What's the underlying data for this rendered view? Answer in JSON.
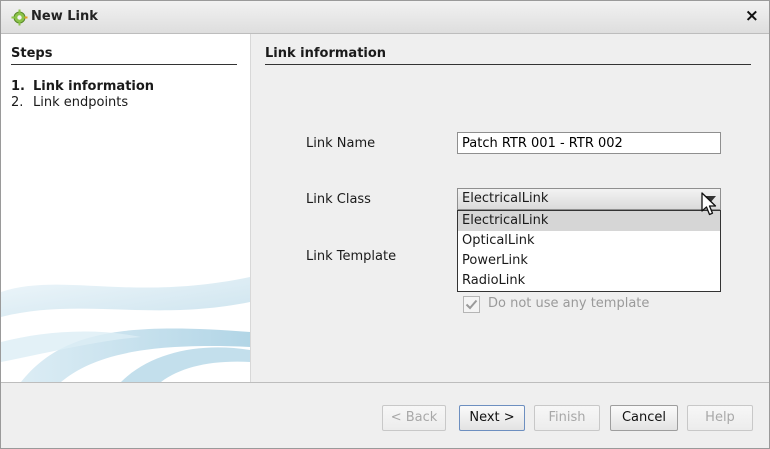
{
  "window": {
    "title": "New Link",
    "close_label": "×",
    "icon": "gear-link-icon"
  },
  "steps": {
    "title": "Steps",
    "items": [
      {
        "num": "1.",
        "label": "Link information",
        "active": true
      },
      {
        "num": "2.",
        "label": "Link endpoints",
        "active": false
      }
    ]
  },
  "content": {
    "title": "Link information",
    "link_name": {
      "label": "Link Name",
      "value": "Patch RTR 001 - RTR 002"
    },
    "link_class": {
      "label": "Link Class",
      "selected": "ElectricalLink",
      "options": [
        "ElectricalLink",
        "OpticalLink",
        "PowerLink",
        "RadioLink"
      ]
    },
    "link_template": {
      "label": "Link Template"
    },
    "no_template_checkbox": {
      "label": "Do not use any template",
      "checked": true,
      "enabled": false
    }
  },
  "footer": {
    "back_label": "< Back",
    "next_label": "Next >",
    "finish_label": "Finish",
    "cancel_label": "Cancel",
    "help_label": "Help"
  },
  "colors": {
    "dialog_bg": "#efefef",
    "steps_bg": "#ffffff",
    "dropdown_selected": "#d6d6d6",
    "disabled_text": "#a8a8a8"
  }
}
